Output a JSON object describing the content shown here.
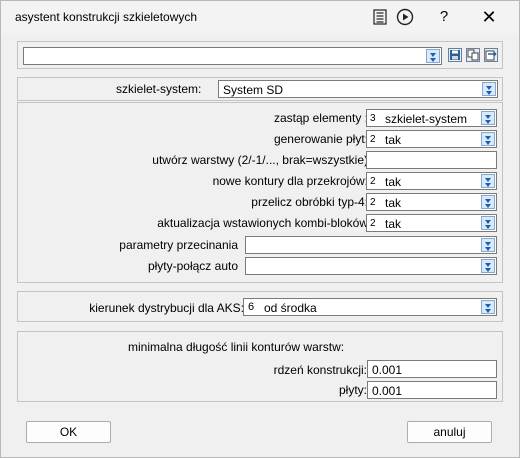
{
  "window": {
    "title": "asystent konstrukcji szkieletowych"
  },
  "top": {
    "path_value": ""
  },
  "system": {
    "label": "szkielet-system:",
    "value": "System SD"
  },
  "rows": {
    "zastap": {
      "label": "zastąp elementy :",
      "num": "3",
      "text": "szkielet-system"
    },
    "generowanie": {
      "label": "generowanie płyt:",
      "num": "2",
      "text": "tak"
    },
    "warstwy": {
      "label": "utwórz warstwy (2/-1/..., brak=wszystkie)",
      "value": ""
    },
    "kontury": {
      "label": "nowe kontury dla przekrojów:",
      "num": "2",
      "text": "tak"
    },
    "obrobki": {
      "label": "przelicz obróbki typ-4:",
      "num": "2",
      "text": "tak"
    },
    "kombi": {
      "label": "aktualizacja wstawionych kombi-bloków",
      "num": "2",
      "text": "tak"
    },
    "przecinania": {
      "label": "parametry przecinania",
      "value": ""
    },
    "plyty_polacz": {
      "label": "płyty-połącz auto",
      "value": ""
    }
  },
  "aks": {
    "label": "kierunek dystrybucji dla AKS:",
    "num": "6",
    "text": "od środka"
  },
  "minimal": {
    "heading": "minimalna długość linii konturów warstw:",
    "rdzen_label": "rdzeń konstrukcji:",
    "rdzen_value": "0.001",
    "plyty_label": "płyty:",
    "plyty_value": "0.001"
  },
  "buttons": {
    "ok": "OK",
    "cancel": "anuluj"
  },
  "titlebar_controls": {
    "help": "?",
    "close": "✕"
  }
}
